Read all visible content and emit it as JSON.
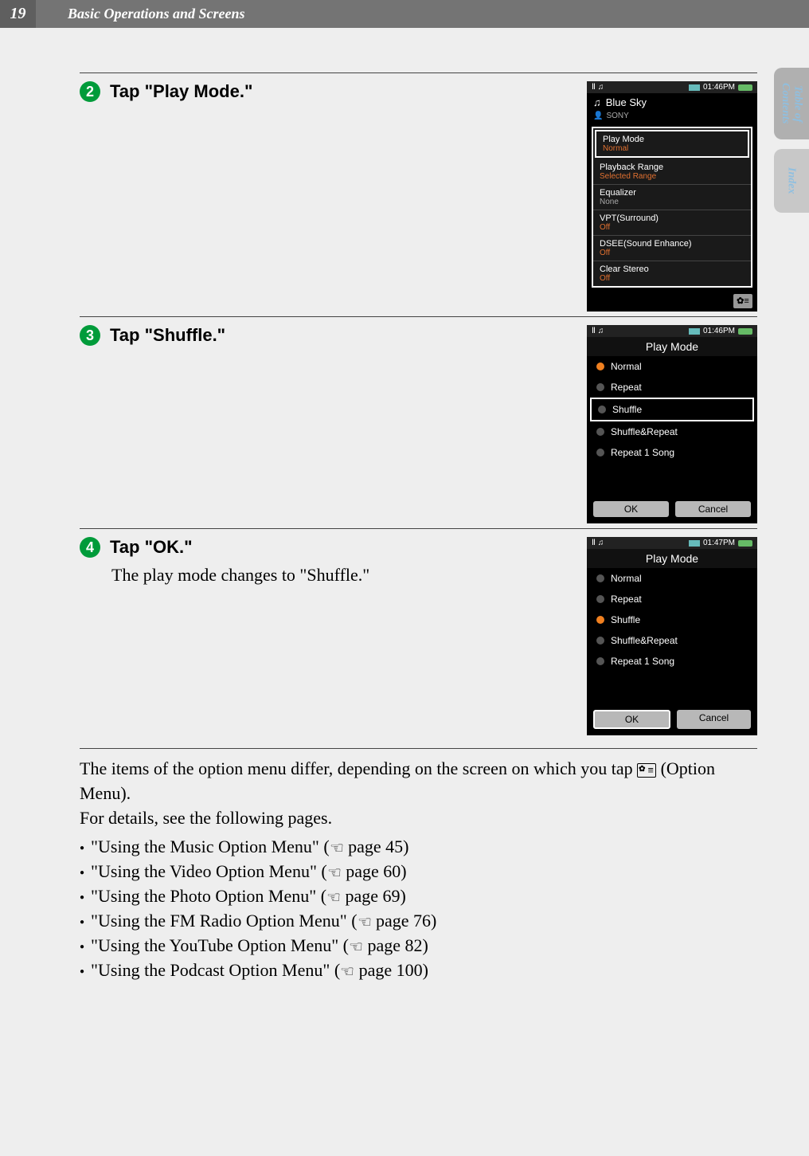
{
  "header": {
    "page_number": "19",
    "chapter": "Basic Operations and Screens"
  },
  "side_tabs": {
    "toc_line1": "Table of",
    "toc_line2": "Contents",
    "index": "Index"
  },
  "steps": [
    {
      "num": "2",
      "title": "Tap \"Play Mode.\"",
      "body": "",
      "shot": {
        "status_time": "01:46PM",
        "track_title": "Blue Sky",
        "artist": "SONY",
        "menu": [
          {
            "label": "Play Mode",
            "sub": "Normal",
            "hl": true,
            "subcolor": "orange"
          },
          {
            "label": "Playback Range",
            "sub": "Selected Range",
            "subcolor": "orange"
          },
          {
            "label": "Equalizer",
            "sub": "None",
            "subcolor": "gray"
          },
          {
            "label": "VPT(Surround)",
            "sub": "Off",
            "subcolor": "orange"
          },
          {
            "label": "DSEE(Sound Enhance)",
            "sub": "Off",
            "subcolor": "orange"
          },
          {
            "label": "Clear Stereo",
            "sub": "Off",
            "subcolor": "orange"
          }
        ]
      }
    },
    {
      "num": "3",
      "title": "Tap \"Shuffle.\"",
      "body": "",
      "shot": {
        "status_time": "01:46PM",
        "screen_title": "Play Mode",
        "selected": 0,
        "hl_index": 2,
        "modes": [
          "Normal",
          "Repeat",
          "Shuffle",
          "Shuffle&Repeat",
          "Repeat 1 Song"
        ],
        "ok": "OK",
        "cancel": "Cancel"
      }
    },
    {
      "num": "4",
      "title": "Tap \"OK.\"",
      "body": "The play mode changes to \"Shuffle.\"",
      "shot": {
        "status_time": "01:47PM",
        "screen_title": "Play Mode",
        "selected": 2,
        "ok_hl": true,
        "modes": [
          "Normal",
          "Repeat",
          "Shuffle",
          "Shuffle&Repeat",
          "Repeat 1 Song"
        ],
        "ok": "OK",
        "cancel": "Cancel"
      }
    }
  ],
  "footer": {
    "p1_a": "The items of the option menu differ, depending on the screen on which you tap ",
    "p1_b": "(Option Menu).",
    "p2": "For details, see the following pages.",
    "bullets": [
      {
        "text": "\"Using the Music Option Menu\" (",
        "page": "page 45)"
      },
      {
        "text": "\"Using the Video Option Menu\" (",
        "page": "page 60)"
      },
      {
        "text": "\"Using the Photo Option Menu\" (",
        "page": "page 69)"
      },
      {
        "text": "\"Using the FM Radio Option Menu\" (",
        "page": "page 76)"
      },
      {
        "text": "\"Using the YouTube Option Menu\" (",
        "page": "page 82)"
      },
      {
        "text": "\"Using the Podcast Option Menu\" (",
        "page": "page 100)"
      }
    ]
  }
}
